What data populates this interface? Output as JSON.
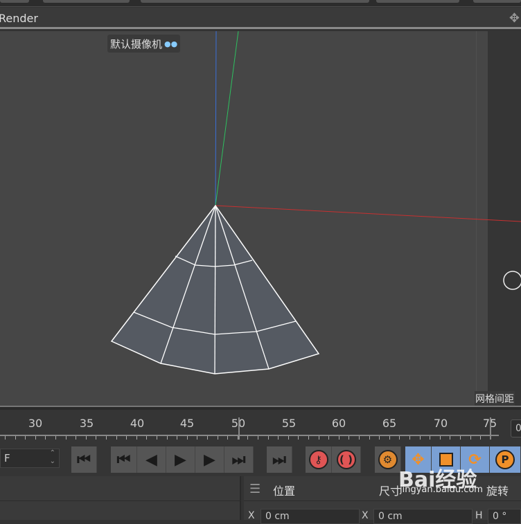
{
  "header": {
    "title": "Render"
  },
  "viewport": {
    "camera_label": "默认摄像机",
    "grid_label": "网格间距"
  },
  "timeline": {
    "labels": [
      "30",
      "35",
      "40",
      "45",
      "50",
      "55",
      "60",
      "65",
      "70",
      "75"
    ],
    "current_frame_partial": "0"
  },
  "frame_field": {
    "value": "F"
  },
  "transport": {
    "buttons": [
      "go-to-start",
      "previous-key",
      "previous-frame",
      "play",
      "next-frame",
      "next-key",
      "go-to-end"
    ]
  },
  "attributes": {
    "position": "位置",
    "size": "尺寸",
    "rotation": "旋转",
    "x_label": "X",
    "h_label": "H",
    "pos_x": "0 cm",
    "size_x": "0 cm",
    "rot_h": "0 °"
  },
  "watermark": {
    "brand": "Bai经验",
    "url": "jingyan.baidu.com"
  },
  "colors": {
    "record": "#e05555",
    "tool_active": "#7aa0d4",
    "tool_icon": "#f0902a"
  }
}
